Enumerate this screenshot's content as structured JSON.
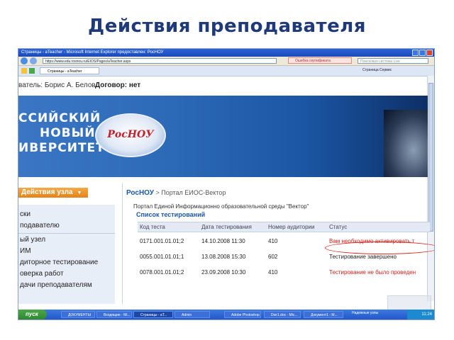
{
  "slide": {
    "title": "Действия преподавателя"
  },
  "browser": {
    "window_title": "Страницы - aTeacher - Microsoft Internet Explorer предоставлен: РосНОУ",
    "url": "https://www.edu.rosnou.ru/EIOS/Pages/aTeacher.aspx",
    "cert_error": "Ошибка сертификата",
    "search_placeholder": "Поисковая система Live",
    "tab_label": "Страницы - aTeacher",
    "toolbar_right": "Страница  Сервис"
  },
  "page": {
    "user_line": "ватель: Борис А. Белов",
    "contract": "Договор: нет",
    "banner_lines": [
      "ССИЙСКИЙ",
      "НОВЫЙ",
      "ИВЕРСИТЕТ"
    ],
    "logo_text": "РосНОУ",
    "actions_button": "Действия узла",
    "sidebar_items": [
      "ски",
      "подавателю",
      "ый узел",
      "ИМ",
      "диторное тестирование",
      "оверка работ",
      "дачи преподавателям"
    ],
    "breadcrumb_site": "РосНОУ",
    "breadcrumb_sep": ">",
    "breadcrumb_page": "Портал ЕИОС-Вектор",
    "portal_text": "Портал Единой Информационно образовательной среды \"Вектор\"",
    "list_title": "Список тестирований",
    "table": {
      "headers": [
        "Код теста",
        "Дата тестирования",
        "Номер аудитории",
        "Статус"
      ],
      "rows": [
        [
          "0171.001.01.01;2",
          "14.10.2008 11:30",
          "410",
          "Вам необходимо активировать т"
        ],
        [
          "0055.001.01.01;1",
          "13.08.2008 15:30",
          "602",
          "Тестирование завершено"
        ],
        [
          "0078.001.01.01;2",
          "23.09.2008 10:30",
          "410",
          "Тестирование не было проведен"
        ]
      ],
      "status_colors": [
        "#d3201a",
        "#222222",
        "#d3201a"
      ]
    }
  },
  "taskbar": {
    "start_label": "пуск",
    "tasks": [
      "ДОКУМЕНТЫ",
      "Входящие - Mi...",
      "Страницы - aT...",
      "Admin",
      "Adobe Photoshop",
      "Dwr1.doc - Mic...",
      "Документ1 - M..."
    ],
    "tray_time": "11:24",
    "tray_status": "Надежные узлы"
  }
}
